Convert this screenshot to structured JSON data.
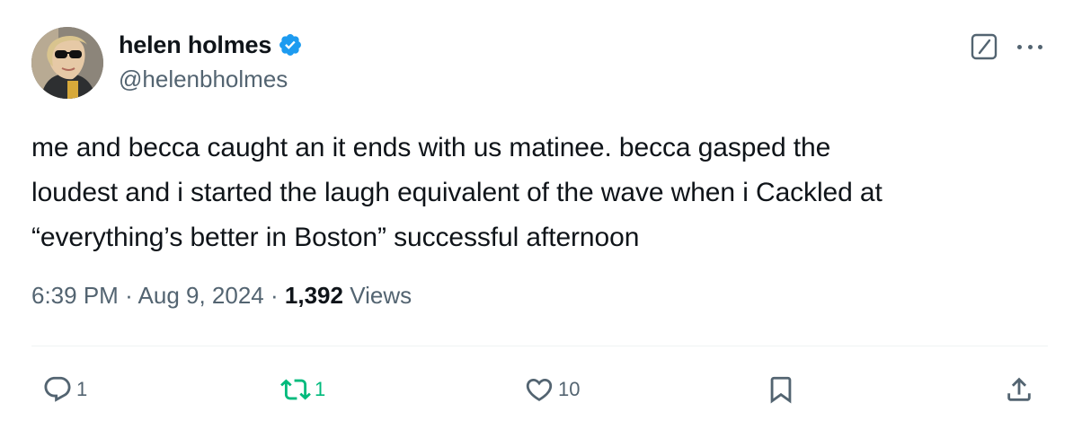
{
  "author": {
    "display_name": "helen holmes",
    "handle": "@helenbholmes",
    "verified": true,
    "verified_color": "#1d9bf0",
    "avatar_icon": "avatar"
  },
  "header_actions": {
    "grok_icon": "grok-icon",
    "more_icon": "more-icon"
  },
  "tweet": {
    "lines": [
      "me and becca caught an it ends with us matinee. becca gasped the",
      "loudest and i started the laugh equivalent of the wave when i Cackled at",
      "“everything’s better in Boston” successful afternoon"
    ],
    "time": "6:39 PM",
    "separator": "·",
    "date": "Aug 9, 2024",
    "views_count": "1,392",
    "views_label": "Views"
  },
  "actions": {
    "reply": {
      "icon": "reply-icon",
      "count": "1"
    },
    "retweet": {
      "icon": "retweet-icon",
      "count": "1",
      "color": "#00ba7c"
    },
    "like": {
      "icon": "heart-icon",
      "count": "10"
    },
    "bookmark": {
      "icon": "bookmark-icon"
    },
    "share": {
      "icon": "share-icon"
    }
  },
  "colors": {
    "text": "#0f1419",
    "secondary": "#536471",
    "divider": "#eff3f4"
  }
}
